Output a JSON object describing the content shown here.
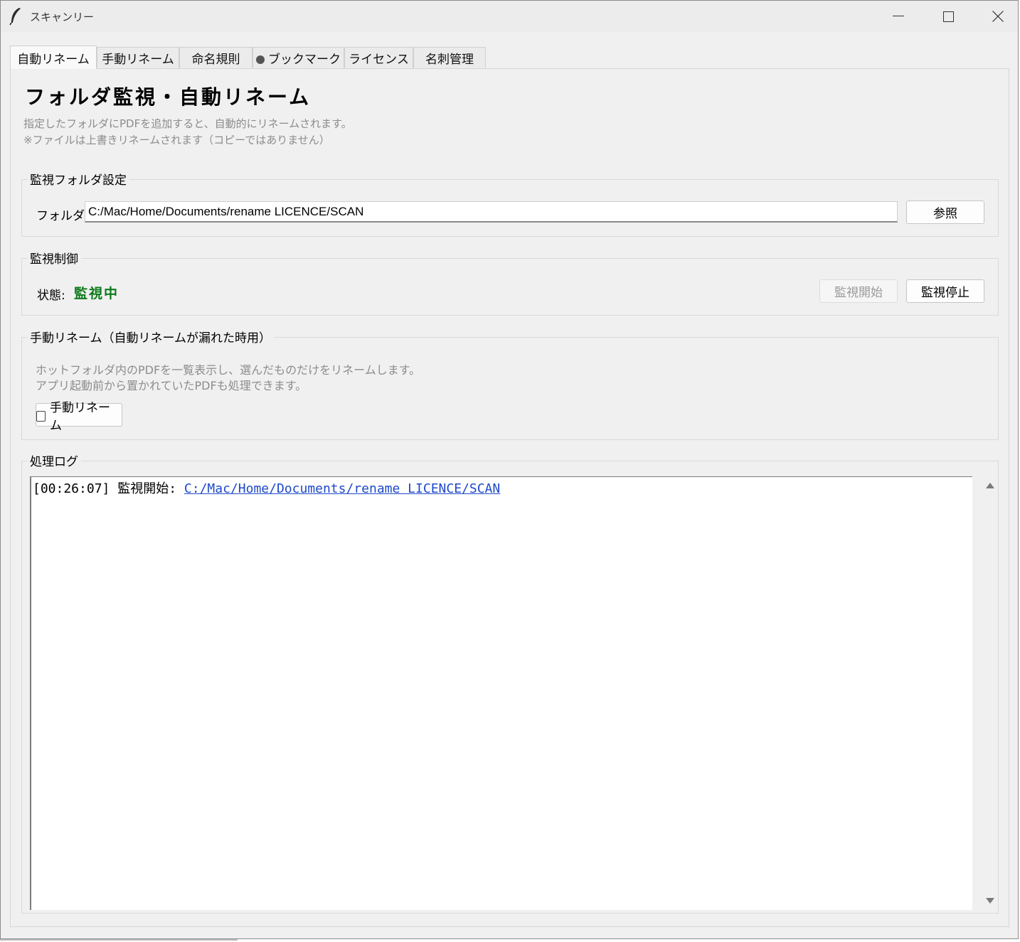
{
  "window": {
    "title": "スキャンリー",
    "icon": "feather-icon",
    "controls": [
      "minimize-icon",
      "maximize-icon",
      "close-icon"
    ]
  },
  "tabs": [
    {
      "label": "自動リネーム",
      "active": true
    },
    {
      "label": "手動リネーム",
      "active": false
    },
    {
      "label": "命名規則",
      "active": false
    },
    {
      "label": "ブックマーク",
      "active": false,
      "icon": "circle-icon"
    },
    {
      "label": "ライセンス",
      "active": false
    },
    {
      "label": "名刺管理",
      "active": false
    }
  ],
  "page": {
    "title": "フォルダ監視・自動リネーム",
    "description_1": "指定したフォルダにPDFを追加すると、自動的にリネームされます。",
    "description_2": "※ファイルは上書きリネームされます（コピーではありません）"
  },
  "folder_settings": {
    "group_label": "監視フォルダ設定",
    "field_label": "フォルダ:",
    "value": "C:/Mac/Home/Documents/rename LICENCE/SCAN",
    "browse_label": "参照"
  },
  "monitor_control": {
    "group_label": "監視制御",
    "status_label": "状態:",
    "status_value": "監視中",
    "status_color": "#0d7a1b",
    "start_label": "監視開始",
    "start_enabled": false,
    "stop_label": "監視停止",
    "stop_enabled": true
  },
  "manual_rename": {
    "group_label": "手動リネーム（自動リネームが漏れた時用）",
    "description_1": "ホットフォルダ内のPDFを一覧表示し、選んだものだけをリネームします。",
    "description_2": "アプリ起動前から置かれていたPDFも処理できます。",
    "button_label": "手動リネーム",
    "button_icon": "document-icon"
  },
  "log": {
    "group_label": "処理ログ",
    "entries": [
      {
        "time": "[00:26:07]",
        "message": "監視開始:",
        "link": "C:/Mac/Home/Documents/rename LICENCE/SCAN"
      }
    ],
    "link_color": "#1f49c9"
  }
}
